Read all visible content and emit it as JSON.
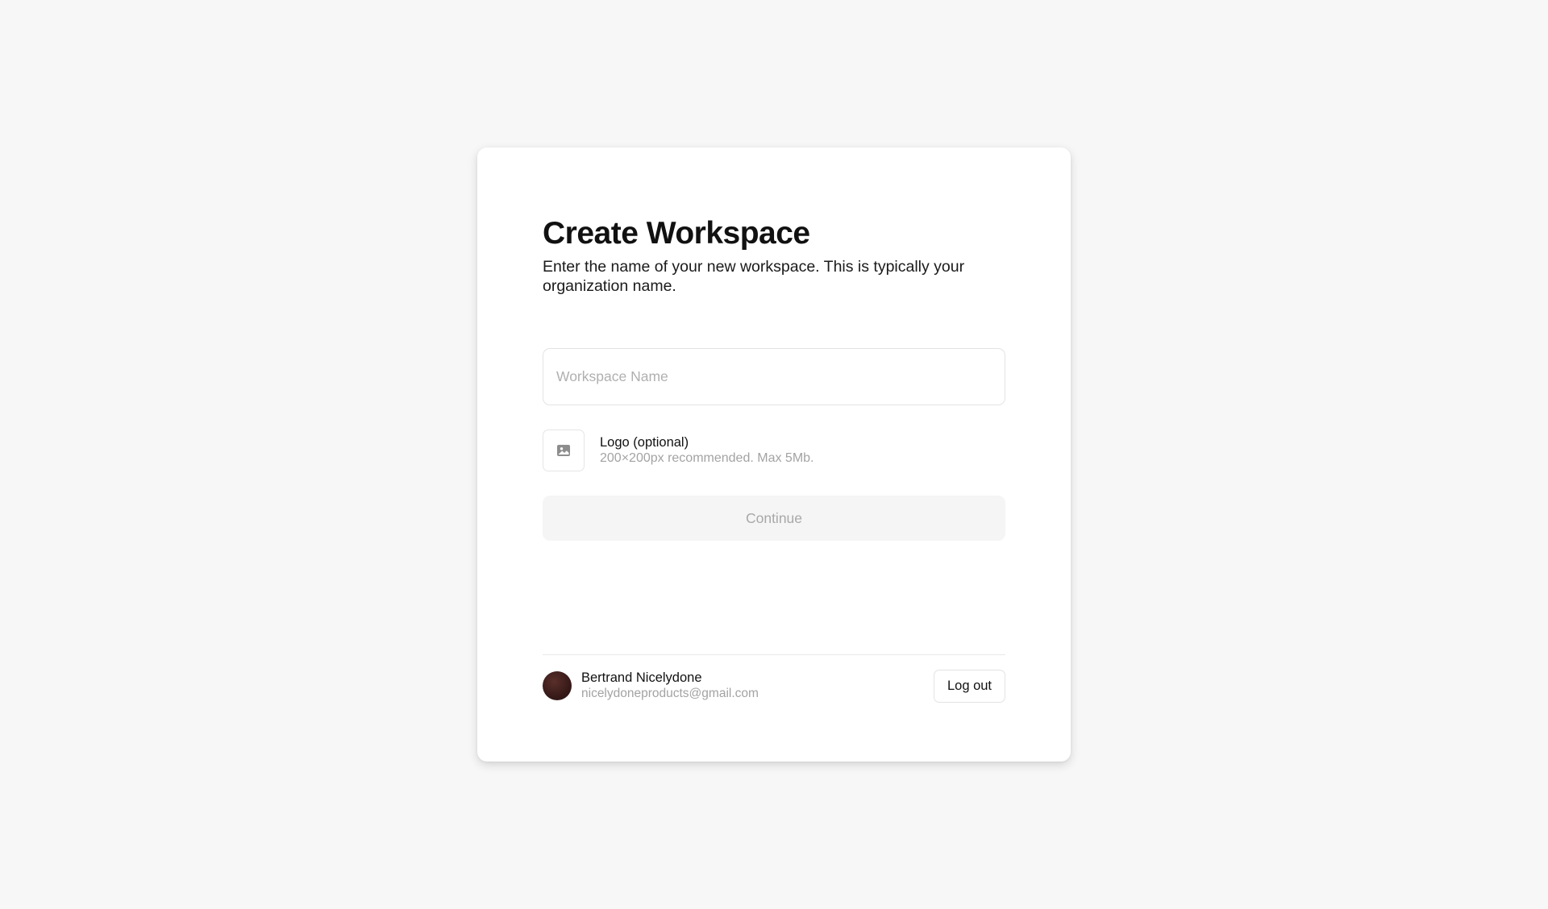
{
  "form": {
    "title": "Create Workspace",
    "subtitle": "Enter the name of your new workspace. This is typically your organization name.",
    "workspace_name_placeholder": "Workspace Name",
    "workspace_name_value": "",
    "logo_label": "Logo (optional)",
    "logo_hint": "200×200px recommended. Max 5Mb.",
    "logo_icon": "image-icon",
    "continue_label": "Continue"
  },
  "user": {
    "name": "Bertrand Nicelydone",
    "email": "nicelydoneproducts@gmail.com",
    "logout_label": "Log out"
  },
  "colors": {
    "background": "#f7f7f7",
    "card": "#ffffff",
    "disabled_button_bg": "#f5f5f5",
    "disabled_button_text": "#a8a8a8",
    "muted_text": "#a3a3a3"
  }
}
